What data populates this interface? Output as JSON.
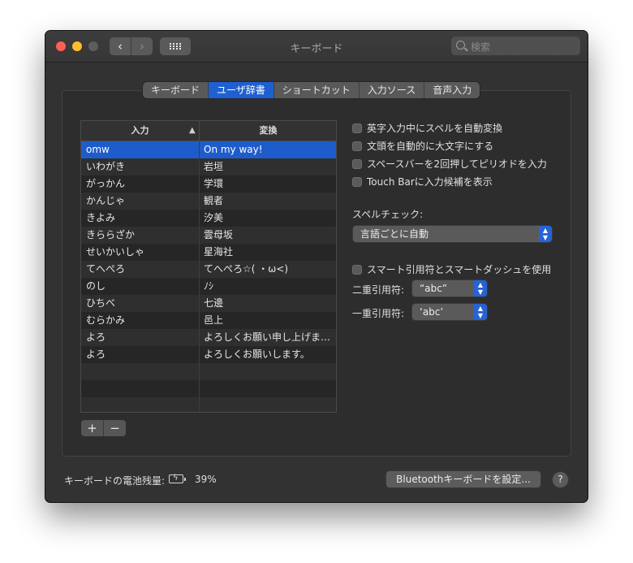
{
  "window": {
    "title": "キーボード",
    "search_placeholder": "検索"
  },
  "tabs": [
    {
      "label": "キーボード",
      "active": false
    },
    {
      "label": "ユーザ辞書",
      "active": true
    },
    {
      "label": "ショートカット",
      "active": false
    },
    {
      "label": "入力ソース",
      "active": false
    },
    {
      "label": "音声入力",
      "active": false
    }
  ],
  "dictionary": {
    "columns": {
      "input": "入力",
      "replace": "変換"
    },
    "sort_indicator": "^",
    "rows": [
      {
        "input": "omw",
        "replace": "On my way!",
        "selected": true
      },
      {
        "input": "いわがき",
        "replace": "岩垣"
      },
      {
        "input": "がっかん",
        "replace": "学環"
      },
      {
        "input": "かんじゃ",
        "replace": "観者"
      },
      {
        "input": "きよみ",
        "replace": "汐美"
      },
      {
        "input": "きららざか",
        "replace": "雲母坂"
      },
      {
        "input": "せいかいしゃ",
        "replace": "星海社"
      },
      {
        "input": "てへぺろ",
        "replace": "てへぺろ☆( ・ω<)"
      },
      {
        "input": "のし",
        "replace": "ﾉｼ"
      },
      {
        "input": "ひちべ",
        "replace": "七邊"
      },
      {
        "input": "むらかみ",
        "replace": "邑上"
      },
      {
        "input": "よろ",
        "replace": "よろしくお願い申し上げま…"
      },
      {
        "input": "よろ",
        "replace": "よろしくお願いします。"
      }
    ],
    "add_label": "+",
    "remove_label": "−"
  },
  "options": {
    "auto_correct": "英字入力中にスペルを自動変換",
    "auto_capitalize": "文頭を自動的に大文字にする",
    "double_space_period": "スペースバーを2回押してピリオドを入力",
    "touch_bar_suggestions": "Touch Barに入力候補を表示",
    "spell_check_label": "スペルチェック:",
    "spell_check_value": "言語ごとに自動",
    "smart_quotes": "スマート引用符とスマートダッシュを使用",
    "double_quote_label": "二重引用符:",
    "double_quote_value": "“abc”",
    "single_quote_label": "一重引用符:",
    "single_quote_value": "‘abc’"
  },
  "footer": {
    "battery_label": "キーボードの電池残量:",
    "battery_value": "39%",
    "setup_button": "Bluetoothキーボードを設定...",
    "help_label": "?"
  },
  "colors": {
    "accent": "#1f60d1",
    "selection": "#1e5ccc",
    "window_bg": "#323232"
  }
}
